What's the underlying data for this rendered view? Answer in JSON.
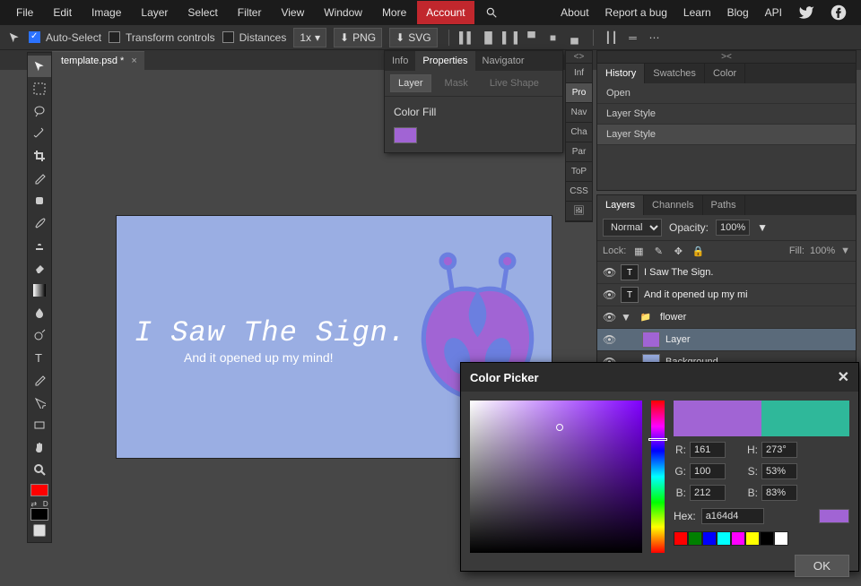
{
  "menu": {
    "items": [
      "File",
      "Edit",
      "Image",
      "Layer",
      "Select",
      "Filter",
      "View",
      "Window",
      "More"
    ],
    "account": "Account",
    "right": [
      "About",
      "Report a bug",
      "Learn",
      "Blog",
      "API"
    ]
  },
  "options": {
    "auto_select": "Auto-Select",
    "transform": "Transform controls",
    "distances": "Distances",
    "zoom": "1x",
    "png": "PNG",
    "svg": "SVG"
  },
  "tab": {
    "name": "template.psd *"
  },
  "prop": {
    "tabs": [
      "Info",
      "Properties",
      "Navigator"
    ],
    "sub": [
      "Layer",
      "Mask",
      "Live Shape"
    ],
    "label": "Color Fill"
  },
  "rstrip": [
    "Inf",
    "Pro",
    "Nav",
    "Cha",
    "Par",
    "ToP",
    "CSS"
  ],
  "history": {
    "tabs": [
      "History",
      "Swatches",
      "Color"
    ],
    "rows": [
      "Open",
      "Layer Style",
      "Layer Style"
    ]
  },
  "layers": {
    "tabs": [
      "Layers",
      "Channels",
      "Paths"
    ],
    "blend": "Normal",
    "opacity_lbl": "Opacity:",
    "opacity": "100%",
    "lock_lbl": "Lock:",
    "fill_lbl": "Fill:",
    "fill": "100%",
    "items": [
      {
        "name": "I Saw The Sign.",
        "type": "T"
      },
      {
        "name": "And it opened up my mi",
        "type": "T"
      },
      {
        "name": "flower",
        "type": "folder"
      },
      {
        "name": "Layer",
        "type": "shape",
        "sel": true,
        "indent": true
      },
      {
        "name": "Background",
        "type": "bg",
        "indent": true
      }
    ]
  },
  "canvas": {
    "h1": "I Saw The Sign.",
    "h2": "And it opened up my mind!"
  },
  "cpk": {
    "title": "Color Picker",
    "r_lbl": "R:",
    "g_lbl": "G:",
    "b_lbl": "B:",
    "h_lbl": "H:",
    "s_lbl": "S:",
    "br_lbl": "B:",
    "hex_lbl": "Hex:",
    "ok": "OK",
    "r": "161",
    "g": "100",
    "b": "212",
    "h": "273°",
    "s": "53%",
    "br": "83%",
    "hex": "a164d4",
    "palette": [
      "#ff0000",
      "#008000",
      "#0000ff",
      "#00ffff",
      "#ff00ff",
      "#ffff00",
      "#000000",
      "#ffffff"
    ],
    "new_color": "#a164d4",
    "old_color": "#2fb89a"
  }
}
